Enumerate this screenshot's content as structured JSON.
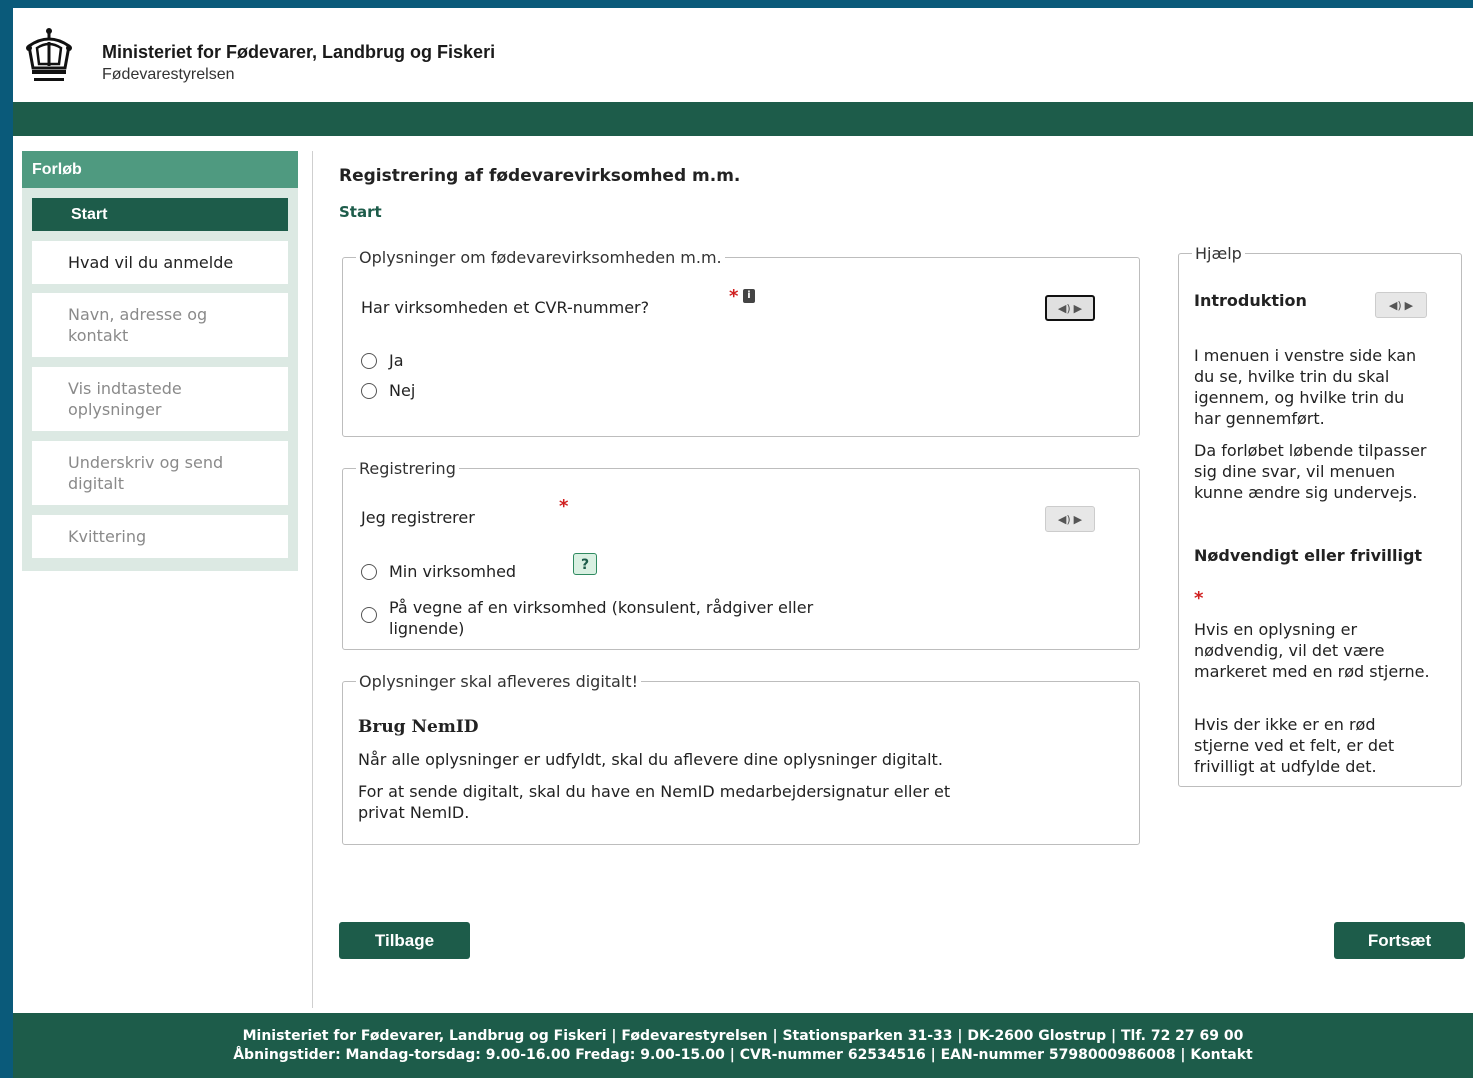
{
  "header": {
    "ministry": "Ministeriet for Fødevarer, Landbrug og Fiskeri",
    "agency": "Fødevarestyrelsen",
    "logo_icon": "crown-icon"
  },
  "sidebar": {
    "title": "Forløb",
    "items": [
      {
        "label": "Start",
        "state": "active"
      },
      {
        "label": "Hvad vil du anmelde",
        "state": "enabled"
      },
      {
        "label": "Navn, adresse og kontakt",
        "state": "disabled"
      },
      {
        "label": "Vis indtastede oplysninger",
        "state": "disabled"
      },
      {
        "label": "Underskriv og send digitalt",
        "state": "disabled"
      },
      {
        "label": "Kvittering",
        "state": "disabled"
      }
    ]
  },
  "main": {
    "title": "Registrering af fødevarevirksomhed m.m.",
    "step": "Start",
    "cvr_section": {
      "legend": "Oplysninger om fødevarevirksomheden m.m.",
      "question": "Har virksomheden et CVR-nummer?",
      "required_mark": "*",
      "info_icon": "i",
      "options": [
        "Ja",
        "Nej"
      ]
    },
    "registration_section": {
      "legend": "Registrering",
      "question": "Jeg registrerer",
      "required_mark": "*",
      "help_icon": "?",
      "options": [
        "Min virksomhed",
        "På vegne af en virksomhed (konsulent, rådgiver eller lignende)"
      ]
    },
    "digital_section": {
      "legend": "Oplysninger skal afleveres digitalt!",
      "heading": "Brug NemID",
      "text1": "Når alle oplysninger er udfyldt, skal du aflevere dine oplysninger digitalt.",
      "text2": "For at sende digitalt, skal du have en NemID medarbejdersignatur eller et privat NemID."
    },
    "back_button": "Tilbage",
    "continue_button": "Fortsæt"
  },
  "help": {
    "legend": "Hjælp",
    "intro_title": "Introduktion",
    "intro_p1": "I menuen i venstre side kan du se, hvilke trin du skal igennem, og hvilke trin du har gennemført.",
    "intro_p2": "Da forløbet løbende tilpasser sig dine svar, vil menuen kunne ændre sig undervejs.",
    "req_title": "Nødvendigt eller frivilligt",
    "req_mark": "*",
    "req_p1": "Hvis en oplysning er nødvendig, vil det være markeret med en rød stjerne.",
    "req_p2": "Hvis der ikke er en rød stjerne ved et felt, er det frivilligt at udfylde det."
  },
  "footer": {
    "line1": "Ministeriet for Fødevarer, Landbrug og Fiskeri | Fødevarestyrelsen | Stationsparken 31-33 | DK-2600 Glostrup | Tlf. 72 27 69 00",
    "line2": "Åbningstider: Mandag-torsdag: 9.00-16.00 Fredag: 9.00-15.00 | CVR-nummer 62534516 | EAN-nummer 5798000986008 | Kontakt"
  },
  "colors": {
    "dark_green": "#1d5c4a",
    "sidebar_head": "#4f9a80",
    "sidebar_bg": "#dce9e3",
    "required": "#d02020",
    "frame": "#0a5a7a"
  }
}
